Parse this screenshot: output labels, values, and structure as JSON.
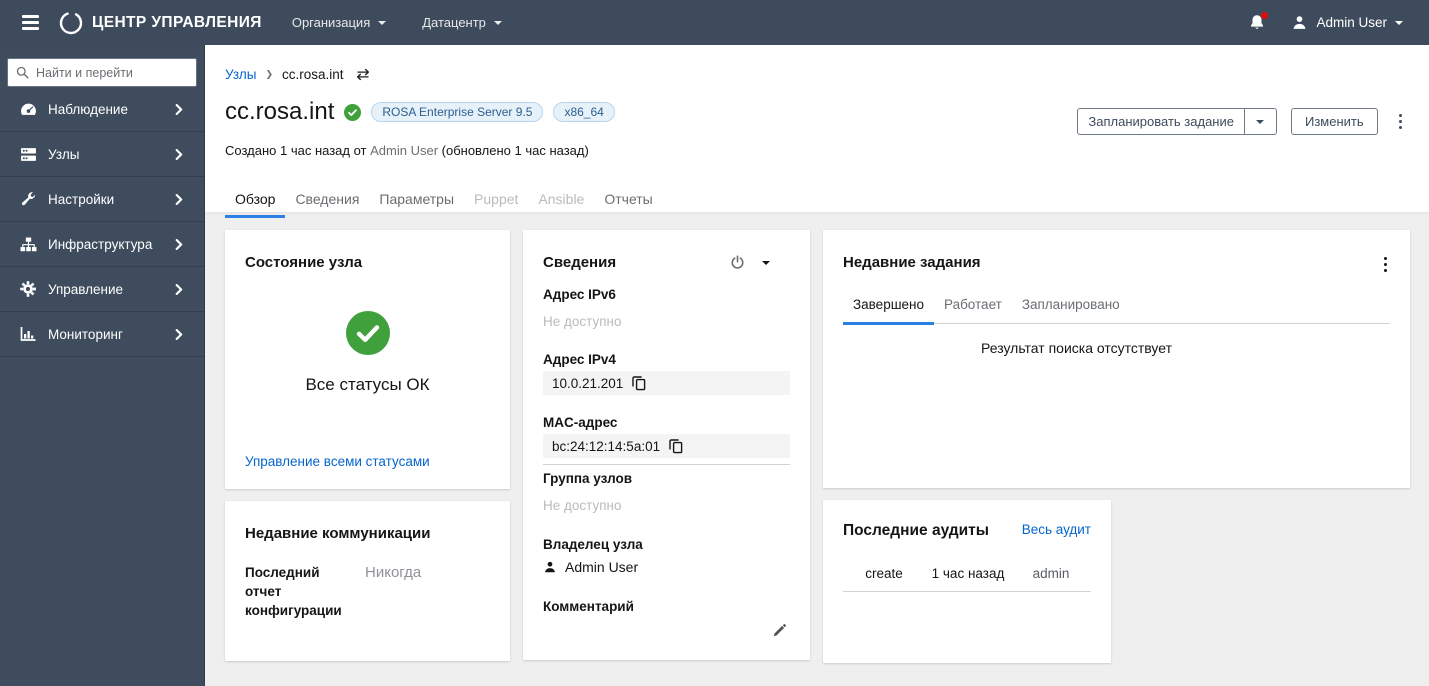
{
  "topbar": {
    "brand": "ЦЕНТР УПРАВЛЕНИЯ",
    "nav": [
      {
        "label": "Организация"
      },
      {
        "label": "Датацентр"
      }
    ],
    "user": "Admin User"
  },
  "sidebar": {
    "search_placeholder": "Найти и перейти",
    "items": [
      {
        "label": "Наблюдение",
        "icon": "tachometer-icon"
      },
      {
        "label": "Узлы",
        "icon": "server-icon"
      },
      {
        "label": "Настройки",
        "icon": "wrench-icon"
      },
      {
        "label": "Инфраструктура",
        "icon": "sitemap-icon"
      },
      {
        "label": "Управление",
        "icon": "gear-icon"
      },
      {
        "label": "Мониторинг",
        "icon": "chart-icon"
      }
    ]
  },
  "header": {
    "breadcrumb": {
      "parent": "Узлы",
      "current": "cc.rosa.int"
    },
    "title": "cc.rosa.int",
    "badges": [
      "ROSA Enterprise Server 9.5",
      "x86_64"
    ],
    "created_prefix": "Создано 1 час назад от ",
    "created_user": "Admin User",
    "created_suffix": " (обновлено 1 час назад)",
    "actions": {
      "schedule": "Запланировать задание",
      "edit": "Изменить"
    },
    "tabs": [
      {
        "label": "Обзор",
        "state": "active"
      },
      {
        "label": "Сведения",
        "state": "normal"
      },
      {
        "label": "Параметры",
        "state": "normal"
      },
      {
        "label": "Puppet",
        "state": "disabled"
      },
      {
        "label": "Ansible",
        "state": "disabled"
      },
      {
        "label": "Отчеты",
        "state": "normal"
      }
    ]
  },
  "cards": {
    "status": {
      "title": "Состояние узла",
      "message": "Все статусы ОК",
      "link": "Управление всеми статусами"
    },
    "communications": {
      "title": "Недавние коммуникации",
      "label": "Последний отчет конфигурации",
      "value": "Никогда"
    },
    "details": {
      "title": "Сведения",
      "fields": [
        {
          "label": "Адрес IPv6",
          "value": "Не доступно"
        },
        {
          "label": "Адрес IPv4",
          "value": "10.0.21.201"
        },
        {
          "label": "MAC-адрес",
          "value": "bc:24:12:14:5a:01"
        },
        {
          "label": "Группа узлов",
          "value": "Не доступно"
        },
        {
          "label": "Владелец узла",
          "value": "Admin User"
        },
        {
          "label": "Комментарий",
          "value": ""
        }
      ]
    },
    "jobs": {
      "title": "Недавние задания",
      "tabs": [
        {
          "label": "Завершено",
          "state": "active"
        },
        {
          "label": "Работает",
          "state": "normal"
        },
        {
          "label": "Запланировано",
          "state": "normal"
        }
      ],
      "empty": "Результат поиска отсутствует"
    },
    "audits": {
      "title": "Последние аудиты",
      "link": "Весь аудит",
      "rows": [
        {
          "action": "create",
          "time": "1 час назад",
          "user": "admin"
        }
      ]
    }
  }
}
